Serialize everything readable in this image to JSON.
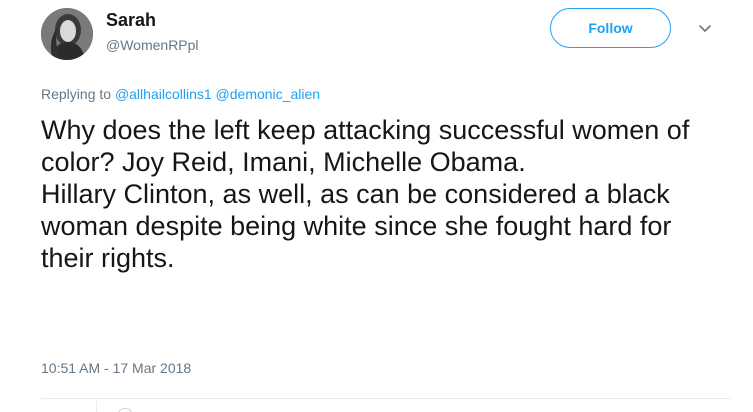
{
  "author": {
    "name": "Sarah",
    "handle": "@WomenRPpl",
    "avatar_icon": "profile-photo-icon"
  },
  "actions": {
    "follow_label": "Follow",
    "more_icon": "chevron-down-icon"
  },
  "reply_context": {
    "prefix": "Replying to",
    "mentions": [
      "@allhailcollins1",
      "@demonic_alien"
    ]
  },
  "tweet": {
    "paragraphs": [
      "Why does the left keep attacking successful women of color? Joy Reid, Imani, Michelle Obama.",
      "Hillary Clinton, as well, as can be considered a black woman despite being white since she fought hard for their rights."
    ],
    "timestamp": "10:51 AM - 17 Mar 2018"
  },
  "colors": {
    "accent": "#1da1f2",
    "secondary_text": "#657786",
    "primary_text": "#14171a",
    "divider": "#e6ecf0"
  }
}
